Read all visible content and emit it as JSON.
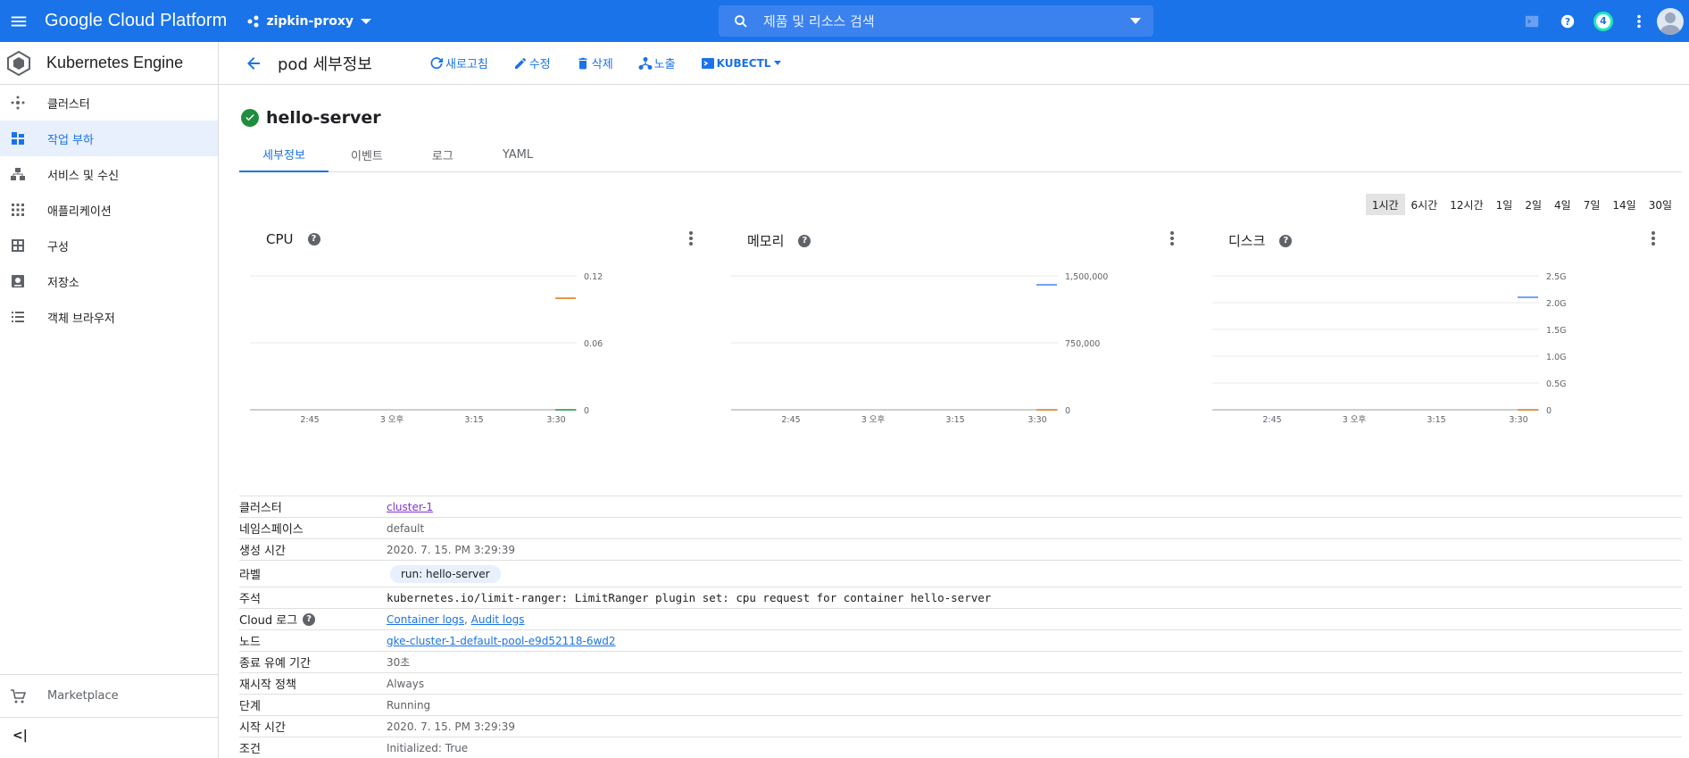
{
  "topbar": {
    "brand": "Google Cloud Platform",
    "project": "zipkin-proxy",
    "search_placeholder": "제품 및 리소스 검색",
    "notification_count": "4",
    "accent_color": "#1a73e8"
  },
  "sidebar": {
    "product": "Kubernetes Engine",
    "items": [
      {
        "label": "클러스터",
        "icon": "cluster-icon"
      },
      {
        "label": "작업 부하",
        "icon": "workloads-icon",
        "active": true
      },
      {
        "label": "서비스 및 수신",
        "icon": "services-icon"
      },
      {
        "label": "애플리케이션",
        "icon": "apps-icon"
      },
      {
        "label": "구성",
        "icon": "config-icon"
      },
      {
        "label": "저장소",
        "icon": "storage-icon"
      },
      {
        "label": "객체 브라우저",
        "icon": "object-browser-icon"
      }
    ],
    "marketplace": "Marketplace",
    "collapse": "<|"
  },
  "actionbar": {
    "title": "pod 세부정보",
    "refresh": "새로고침",
    "edit": "수정",
    "delete": "삭제",
    "expose": "노출",
    "kubectl": "KUBECTL"
  },
  "pod": {
    "name": "hello-server",
    "status": "ok"
  },
  "tabs": [
    "세부정보",
    "이벤트",
    "로그",
    "YAML"
  ],
  "time_ranges": [
    "1시간",
    "6시간",
    "12시간",
    "1일",
    "2일",
    "4일",
    "7일",
    "14일",
    "30일"
  ],
  "active_range": "1시간",
  "charts": [
    {
      "title": "CPU",
      "yticks": [
        "0.12",
        "0.06",
        "0"
      ],
      "xticks": [
        "2:45",
        "3 오후",
        "3:15",
        "3:30"
      ]
    },
    {
      "title": "메모리",
      "yticks": [
        "1,500,000",
        "750,000",
        "0"
      ],
      "xticks": [
        "2:45",
        "3 오후",
        "3:15",
        "3:30"
      ]
    },
    {
      "title": "디스크",
      "yticks": [
        "2.5G",
        "2.0G",
        "1.5G",
        "1.0G",
        "0.5G",
        "0"
      ],
      "xticks": [
        "2:45",
        "3 오후",
        "3:15",
        "3:30"
      ]
    }
  ],
  "chart_data": [
    {
      "type": "line",
      "title": "CPU",
      "ylim": [
        0,
        0.12
      ],
      "x": [
        "3:30"
      ],
      "series": [
        {
          "color": "#e8710a",
          "values": [
            0.1
          ]
        },
        {
          "color": "#1e8e3e",
          "values": [
            0
          ]
        }
      ]
    },
    {
      "type": "line",
      "title": "메모리",
      "ylim": [
        0,
        1500000
      ],
      "x": [
        "3:30"
      ],
      "series": [
        {
          "color": "#4285f4",
          "values": [
            1400000
          ]
        },
        {
          "color": "#e8710a",
          "values": [
            0
          ]
        }
      ]
    },
    {
      "type": "line",
      "title": "디스크",
      "ylim": [
        0,
        2500000000
      ],
      "x": [
        "3:30"
      ],
      "series": [
        {
          "color": "#4285f4",
          "values": [
            2100000000
          ]
        },
        {
          "color": "#e8710a",
          "values": [
            0
          ]
        }
      ]
    }
  ],
  "details": {
    "cluster_label": "클러스터",
    "cluster": "cluster-1",
    "namespace_label": "네임스페이스",
    "namespace": "default",
    "created_label": "생성 시간",
    "created": "2020. 7. 15. PM 3:29:39",
    "labels_label": "라벨",
    "label_chip": "run: hello-server",
    "annotations_label": "주석",
    "annotations": "kubernetes.io/limit-ranger: LimitRanger plugin set: cpu request for container hello-server",
    "cloud_logs_label": "Cloud 로그",
    "container_logs": "Container logs",
    "audit_logs": "Audit logs",
    "node_label": "노드",
    "node": "gke-cluster-1-default-pool-e9d52118-6wd2",
    "grace_label": "종료 유예 기간",
    "grace": "30초",
    "restart_label": "재시작 정책",
    "restart": "Always",
    "phase_label": "단계",
    "phase": "Running",
    "start_label": "시작 시간",
    "start": "2020. 7. 15. PM 3:29:39",
    "conditions_label": "조건",
    "conditions": "Initialized: True"
  }
}
